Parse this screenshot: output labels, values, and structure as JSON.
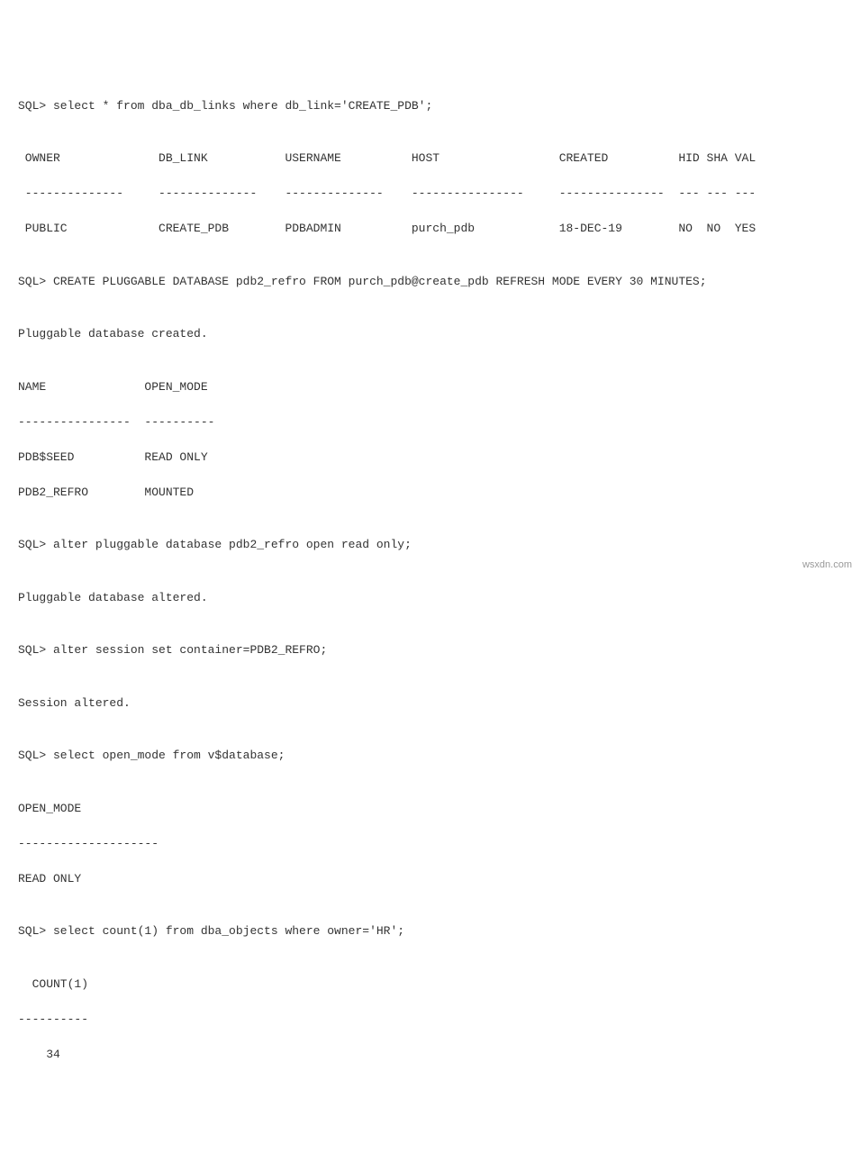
{
  "lines": {
    "l1": "SQL> select * from dba_db_links where db_link='CREATE_PDB';",
    "l2": "",
    "l3": " OWNER              DB_LINK           USERNAME          HOST                 CREATED          HID SHA VAL",
    "l4": " --------------     --------------    --------------    ----------------     ---------------  --- --- ---",
    "l5": " PUBLIC             CREATE_PDB        PDBADMIN          purch_pdb            18-DEC-19        NO  NO  YES",
    "l6": "",
    "l7": "SQL> CREATE PLUGGABLE DATABASE pdb2_refro FROM purch_pdb@create_pdb REFRESH MODE EVERY 30 MINUTES;",
    "l8": "",
    "l9": "Pluggable database created.",
    "l10": "",
    "l11": "NAME              OPEN_MODE",
    "l12": "----------------  ----------",
    "l13": "PDB$SEED          READ ONLY",
    "l14": "PDB2_REFRO        MOUNTED",
    "l15": "",
    "l16": "SQL> alter pluggable database pdb2_refro open read only;",
    "l17": "",
    "l18": "Pluggable database altered.",
    "l19": "",
    "l20": "SQL> alter session set container=PDB2_REFRO;",
    "l21": "",
    "l22": "Session altered.",
    "l23": "",
    "l24": "SQL> select open_mode from v$database;",
    "l25": "",
    "l26": "OPEN_MODE",
    "l27": "--------------------",
    "l28": "READ ONLY",
    "l29": "",
    "l30": "SQL> select count(1) from dba_objects where owner='HR';",
    "l31": "",
    "l32": "  COUNT(1)",
    "l33": "----------",
    "l34": "    34"
  },
  "watermark": "wsxdn.com"
}
